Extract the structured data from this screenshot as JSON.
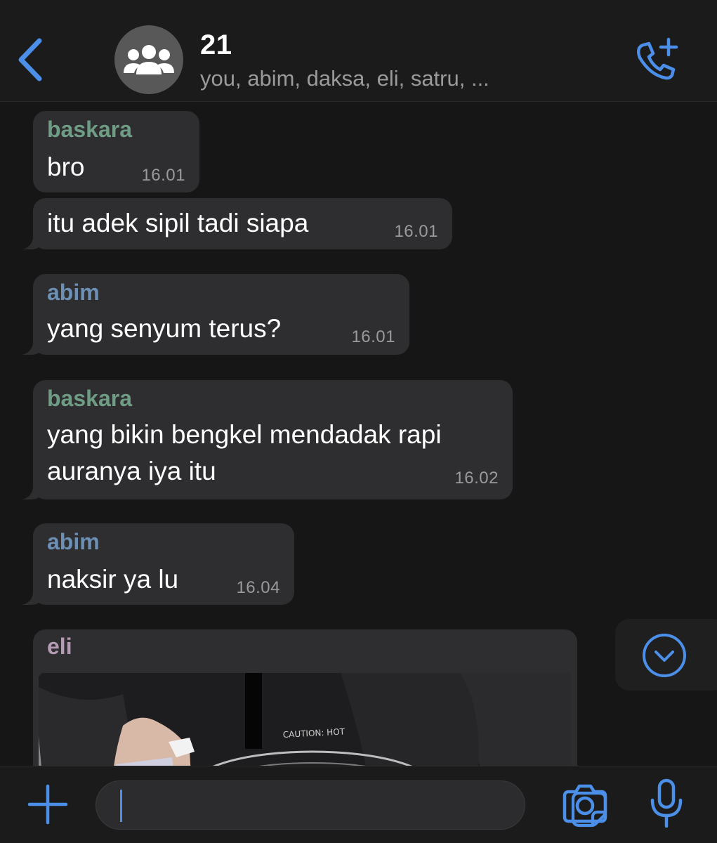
{
  "colors": {
    "accent": "#4c8fe8",
    "sender_baskara": "#6f9c85",
    "sender_abim": "#6c8fb3",
    "sender_eli": "#b49ab2"
  },
  "header": {
    "back_icon": "chevron-left-icon",
    "avatar_icon": "group-icon",
    "title": "21",
    "members": "you, abim, daksa, eli, satru, ...",
    "call_icon": "phone-plus-icon"
  },
  "messages": [
    {
      "sender": "baskara",
      "text": "bro",
      "time": "16.01"
    },
    {
      "text": "itu adek sipil tadi siapa",
      "time": "16.01"
    },
    {
      "sender": "abim",
      "text": "yang senyum terus?",
      "time": "16.01"
    },
    {
      "sender": "baskara",
      "lines": [
        "yang bikin bengkel mendadak rapi",
        "auranya iya itu"
      ],
      "time": "16.02"
    },
    {
      "sender": "abim",
      "text": "naksir ya lu",
      "time": "16.04"
    },
    {
      "sender": "eli",
      "type": "photo",
      "photo_text": "CAUTION: HOT"
    }
  ],
  "scroll_icon": "chevron-down-circle-icon",
  "input_bar": {
    "plus_icon": "plus-icon",
    "text_value": "",
    "sticker_icon": "sticker-icon",
    "camera_icon": "camera-icon",
    "mic_icon": "microphone-icon"
  }
}
